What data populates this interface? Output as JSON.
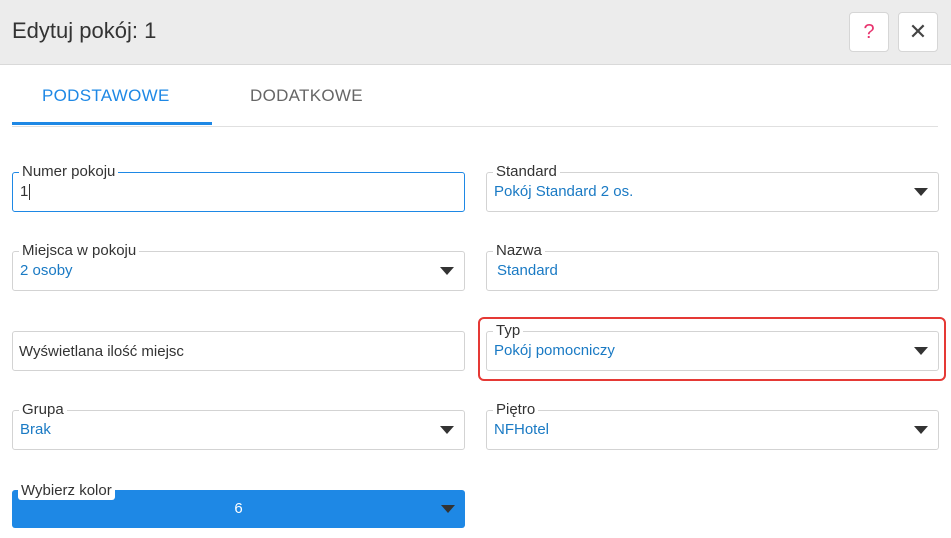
{
  "header": {
    "title": "Edytuj pokój: 1",
    "help_icon": "?",
    "close_icon": "✕"
  },
  "tabs": [
    {
      "label": "PODSTAWOWE",
      "active": true
    },
    {
      "label": "DODATKOWE",
      "active": false
    }
  ],
  "form": {
    "room_number": {
      "label": "Numer pokoju",
      "value": "1"
    },
    "standard": {
      "label": "Standard",
      "value": "Pokój Standard 2 os."
    },
    "places": {
      "label": "Miejsca w pokoju",
      "value": "2 osoby"
    },
    "name": {
      "label": "Nazwa",
      "value": "Standard"
    },
    "displayed_places": {
      "placeholder": "Wyświetlana ilość miejsc"
    },
    "type": {
      "label": "Typ",
      "value": "Pokój pomocniczy"
    },
    "group": {
      "label": "Grupa",
      "value": "Brak"
    },
    "floor": {
      "label": "Piętro",
      "value": "NFHotel"
    },
    "color": {
      "label": "Wybierz kolor",
      "value": "6",
      "color": "#1e88e5"
    }
  },
  "colors": {
    "accent": "#1e88e5",
    "highlight": "#e53935",
    "help": "#e8336e"
  }
}
